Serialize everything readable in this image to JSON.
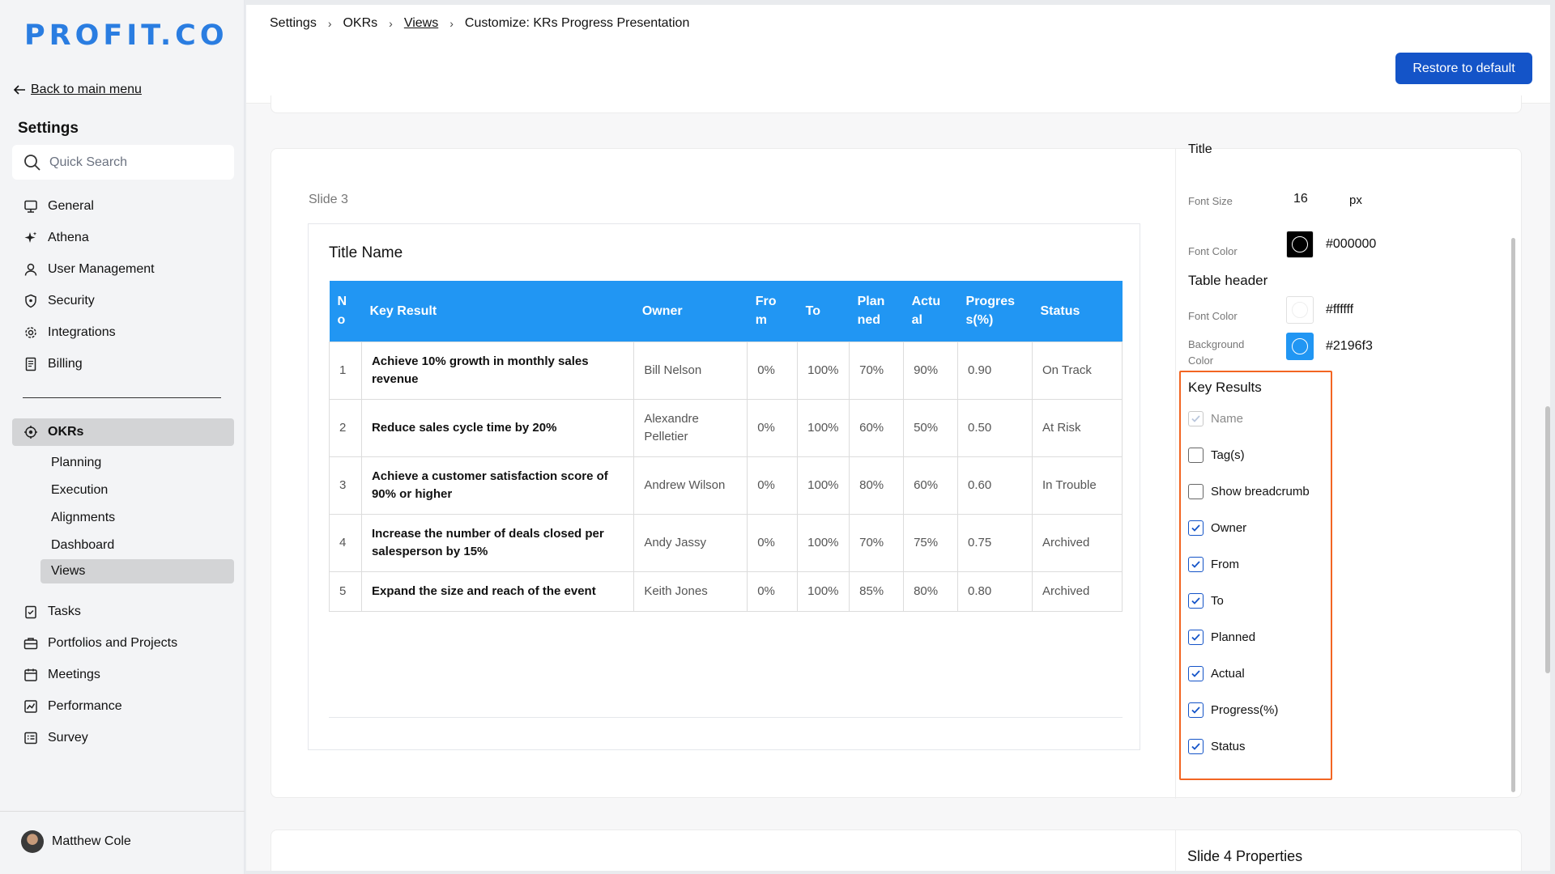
{
  "logo": "PROFIT.CO",
  "sidebar": {
    "back_label": "Back to main menu",
    "settings_title": "Settings",
    "search_placeholder": "Quick Search",
    "items": [
      {
        "label": "General",
        "icon": "monitor-icon"
      },
      {
        "label": "Athena",
        "icon": "sparkle-icon"
      },
      {
        "label": "User Management",
        "icon": "user-icon"
      },
      {
        "label": "Security",
        "icon": "shield-icon"
      },
      {
        "label": "Integrations",
        "icon": "gear-icon"
      },
      {
        "label": "Billing",
        "icon": "receipt-icon"
      }
    ],
    "okrs_label": "OKRs",
    "okr_subitems": [
      "Planning",
      "Execution",
      "Alignments",
      "Dashboard",
      "Views"
    ],
    "items2": [
      {
        "label": "Tasks",
        "icon": "clipboard-check-icon"
      },
      {
        "label": "Portfolios and Projects",
        "icon": "briefcase-icon"
      },
      {
        "label": "Meetings",
        "icon": "calendar-icon"
      },
      {
        "label": "Performance",
        "icon": "trend-chart-icon"
      },
      {
        "label": "Survey",
        "icon": "survey-list-icon"
      }
    ],
    "user_name": "Matthew Cole"
  },
  "breadcrumb": {
    "items": [
      "Settings",
      "OKRs",
      "Views",
      "Customize: KRs Progress Presentation"
    ]
  },
  "restore_label": "Restore to default",
  "slide": {
    "label": "Slide 3",
    "title": "Title Name",
    "headers": [
      "N\no",
      "Key Result",
      "Owner",
      "Fro\nm",
      "To",
      "Plan\nned",
      "Actu\nal",
      "Progres\ns(%)",
      "Status"
    ],
    "rows": [
      [
        "1",
        "Achieve 10% growth in monthly sales revenue",
        "Bill Nelson",
        "0%",
        "100%",
        "70%",
        "90%",
        "0.90",
        "On Track"
      ],
      [
        "2",
        "Reduce sales cycle time by 20%",
        "Alexandre Pelletier",
        "0%",
        "100%",
        "60%",
        "50%",
        "0.50",
        "At Risk"
      ],
      [
        "3",
        "Achieve a customer satisfaction score of 90% or higher",
        "Andrew Wilson",
        "0%",
        "100%",
        "80%",
        "60%",
        "0.60",
        "In Trouble"
      ],
      [
        "4",
        "Increase the number of deals closed per salesperson by 15%",
        "Andy Jassy",
        "0%",
        "100%",
        "70%",
        "75%",
        "0.75",
        "Archived"
      ],
      [
        "5",
        "Expand the size and reach of the event",
        "Keith Jones",
        "0%",
        "100%",
        "85%",
        "80%",
        "0.80",
        "Archived"
      ]
    ]
  },
  "panel": {
    "title_top": "Title",
    "font_size_label": "Font Size",
    "font_size_value": "16",
    "font_size_unit": "px",
    "font_color_label": "Font Color",
    "title_color": "#000000",
    "table_header_label": "Table header",
    "th_font_color_label": "Font Color",
    "th_font_color": "#ffffff",
    "th_bg_label": "Background Color",
    "th_bg_color": "#2196f3",
    "key_results_label": "Key Results",
    "checkboxes": [
      {
        "label": "Name",
        "checked": true,
        "disabled": true
      },
      {
        "label": "Tag(s)",
        "checked": false
      },
      {
        "label": "Show breadcrumb",
        "checked": false
      },
      {
        "label": "Owner",
        "checked": true
      },
      {
        "label": "From",
        "checked": true
      },
      {
        "label": "To",
        "checked": true
      },
      {
        "label": "Planned",
        "checked": true
      },
      {
        "label": "Actual",
        "checked": true
      },
      {
        "label": "Progress(%)",
        "checked": true
      },
      {
        "label": "Status",
        "checked": true
      }
    ]
  },
  "next_card_title": "Slide 4 Properties"
}
